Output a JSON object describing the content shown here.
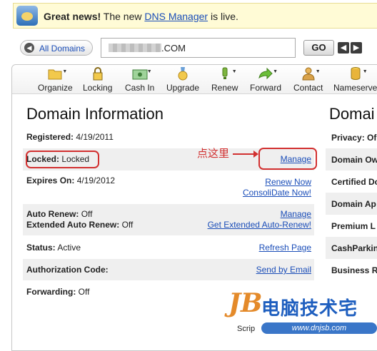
{
  "banner": {
    "headline": "Great news!",
    "text_before": "The new",
    "link": "DNS Manager",
    "text_after": "is live."
  },
  "search": {
    "all_domains": "All Domains",
    "domain_suffix": ".COM",
    "go": "GO",
    "prev": "◀",
    "next": "▶"
  },
  "toolbar": {
    "items": [
      {
        "label": "Organize",
        "icon": "folder-icon"
      },
      {
        "label": "Locking",
        "icon": "lock-icon"
      },
      {
        "label": "Cash In",
        "icon": "cash-icon"
      },
      {
        "label": "Upgrade",
        "icon": "medal-icon"
      },
      {
        "label": "Renew",
        "icon": "renew-icon"
      },
      {
        "label": "Forward",
        "icon": "forward-arrow-icon"
      },
      {
        "label": "Contact",
        "icon": "contact-person-icon"
      },
      {
        "label": "Nameserve",
        "icon": "database-icon"
      }
    ]
  },
  "main": {
    "title": "Domain Information",
    "registered_label": "Registered:",
    "registered_value": "4/19/2011",
    "locked_label": "Locked:",
    "locked_value": "Locked",
    "locked_action": "Manage",
    "expires_label": "Expires On:",
    "expires_value": "4/19/2012",
    "renew_now": "Renew Now",
    "consolidate_now": "ConsoliDate Now!",
    "auto_renew_label": "Auto Renew:",
    "auto_renew_value": "Off",
    "auto_renew_action": "Manage",
    "ext_auto_renew_label": "Extended Auto Renew:",
    "ext_auto_renew_value": "Off",
    "ext_auto_renew_action": "Get Extended Auto-Renew!",
    "status_label": "Status:",
    "status_value": "Active",
    "refresh_page": "Refresh Page",
    "auth_code_label": "Authorization Code:",
    "send_by_email": "Send by Email",
    "forwarding_label": "Forwarding:",
    "forwarding_value": "Off"
  },
  "right": {
    "title": "Domai",
    "items": [
      "Privacy: Of",
      "Domain Ow",
      "Certified Do",
      "Domain Ap",
      "Premium L",
      "CashParkin",
      "Business R"
    ]
  },
  "annotation": {
    "text": "点这里"
  },
  "watermark": {
    "logo": "JB",
    "text": "电脑技术宅",
    "url": "www.dnjsb.com",
    "script": "Scrip"
  }
}
